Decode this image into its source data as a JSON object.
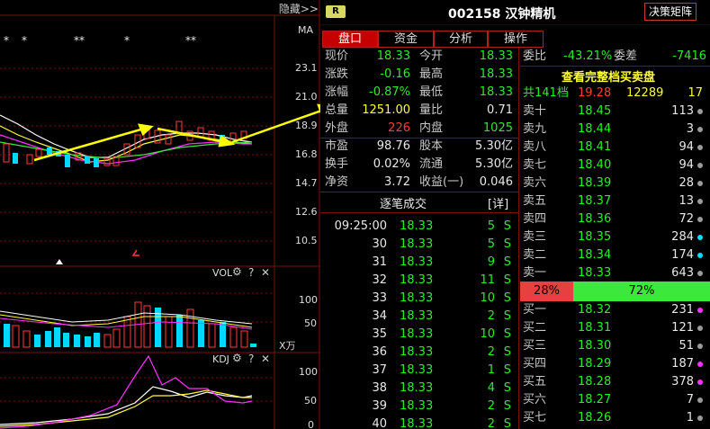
{
  "chart": {
    "hide_label": "隐藏>>",
    "ma_label": "MA",
    "star_markers": [
      "*",
      "*",
      "**",
      "*",
      "**"
    ],
    "price_ticks": [
      "23.1",
      "21.0",
      "18.9",
      "16.8",
      "14.7",
      "12.6",
      "10.5"
    ],
    "vol_label": "VOL",
    "vol_ticks": [
      "100",
      "50"
    ],
    "vol_unit": "X万",
    "kdj_label": "KDJ",
    "kdj_ticks": [
      "100",
      "50",
      "0"
    ],
    "gear_icon": "gear-icon",
    "help_icon": "question-icon",
    "close_icon": "close-icon"
  },
  "stock": {
    "badge": "R",
    "code_name": "002158 汉钟精机",
    "decision_button": "决策矩阵"
  },
  "tabs": [
    {
      "label": "盘口",
      "active": true
    },
    {
      "label": "资金",
      "active": false
    },
    {
      "label": "分析",
      "active": false
    },
    {
      "label": "操作",
      "active": false
    }
  ],
  "quote": [
    {
      "l1": "现价",
      "v1": "18.33",
      "c1": "green",
      "l2": "今开",
      "v2": "18.33",
      "c2": "green"
    },
    {
      "l1": "涨跌",
      "v1": "-0.16",
      "c1": "green",
      "l2": "最高",
      "v2": "18.33",
      "c2": "green"
    },
    {
      "l1": "涨幅",
      "v1": "-0.87%",
      "c1": "green",
      "l2": "最低",
      "v2": "18.33",
      "c2": "green"
    },
    {
      "l1": "总量",
      "v1": "1251.00",
      "c1": "yellow",
      "l2": "量比",
      "v2": "0.71",
      "c2": "white"
    },
    {
      "l1": "外盘",
      "v1": "226",
      "c1": "red",
      "l2": "内盘",
      "v2": "1025",
      "c2": "green"
    }
  ],
  "quote2": [
    {
      "l1": "市盈",
      "v1": "98.76",
      "l2": "股本",
      "v2": "5.30亿"
    },
    {
      "l1": "换手",
      "v1": "0.02%",
      "l2": "流通",
      "v2": "5.30亿"
    },
    {
      "l1": "净资",
      "v1": "3.72",
      "l2": "收益(一)",
      "v2": "0.046"
    }
  ],
  "trades": {
    "title": "逐笔成交",
    "detail": "[详]",
    "rows": [
      {
        "t": "09:25:00",
        "p": "18.33",
        "v": "5",
        "s": "S"
      },
      {
        "t": "30",
        "p": "18.33",
        "v": "5",
        "s": "S"
      },
      {
        "t": "31",
        "p": "18.33",
        "v": "9",
        "s": "S"
      },
      {
        "t": "32",
        "p": "18.33",
        "v": "11",
        "s": "S"
      },
      {
        "t": "33",
        "p": "18.33",
        "v": "10",
        "s": "S"
      },
      {
        "t": "34",
        "p": "18.33",
        "v": "2",
        "s": "S"
      },
      {
        "t": "35",
        "p": "18.33",
        "v": "10",
        "s": "S"
      },
      {
        "t": "36",
        "p": "18.33",
        "v": "2",
        "s": "S"
      },
      {
        "t": "37",
        "p": "18.33",
        "v": "1",
        "s": "S"
      },
      {
        "t": "38",
        "p": "18.33",
        "v": "4",
        "s": "S"
      },
      {
        "t": "39",
        "p": "18.33",
        "v": "2",
        "s": "S"
      },
      {
        "t": "40",
        "p": "18.33",
        "v": "2",
        "s": "S"
      }
    ]
  },
  "orderbook": {
    "weibi_label": "委比",
    "weibi_value": "-43.21%",
    "weicha_label": "委差",
    "weicha_value": "-7416",
    "full_link": "查看完整档买卖盘",
    "summary": {
      "label": "共141档",
      "price": "19.28",
      "vol": "12289",
      "count": "17"
    },
    "asks": [
      {
        "label": "卖十",
        "price": "18.45",
        "vol": "113",
        "dot": "gray"
      },
      {
        "label": "卖九",
        "price": "18.44",
        "vol": "3",
        "dot": "gray"
      },
      {
        "label": "卖八",
        "price": "18.41",
        "vol": "94",
        "dot": "gray"
      },
      {
        "label": "卖七",
        "price": "18.40",
        "vol": "94",
        "dot": "gray"
      },
      {
        "label": "卖六",
        "price": "18.39",
        "vol": "28",
        "dot": "gray"
      },
      {
        "label": "卖五",
        "price": "18.37",
        "vol": "13",
        "dot": "gray"
      },
      {
        "label": "卖四",
        "price": "18.36",
        "vol": "72",
        "dot": "gray"
      },
      {
        "label": "卖三",
        "price": "18.35",
        "vol": "284",
        "dot": "cyan"
      },
      {
        "label": "卖二",
        "price": "18.34",
        "vol": "174",
        "dot": "cyan"
      },
      {
        "label": "卖一",
        "price": "18.33",
        "vol": "643",
        "dot": "gray"
      }
    ],
    "ratio_left": "28%",
    "ratio_right": "72%",
    "ratio_left_fraction": 0.28,
    "bids": [
      {
        "label": "买一",
        "price": "18.32",
        "vol": "231",
        "dot": "magenta"
      },
      {
        "label": "买二",
        "price": "18.31",
        "vol": "121",
        "dot": "gray"
      },
      {
        "label": "买三",
        "price": "18.30",
        "vol": "51",
        "dot": "gray"
      },
      {
        "label": "买四",
        "price": "18.29",
        "vol": "187",
        "dot": "magenta"
      },
      {
        "label": "买五",
        "price": "18.28",
        "vol": "378",
        "dot": "magenta"
      },
      {
        "label": "买六",
        "price": "18.27",
        "vol": "7",
        "dot": "gray"
      },
      {
        "label": "买七",
        "price": "18.26",
        "vol": "1",
        "dot": "gray"
      }
    ]
  },
  "colors": {
    "up": "#ff3c3c",
    "down": "#2eea2e",
    "volume": "#ffff3c",
    "border": "#7a0f0f",
    "tab_active": "#c40000",
    "buy_bar": "#e84040",
    "sell_bar": "#3ce83c",
    "cyan": "#00e0ff",
    "magenta": "#ff30ff"
  }
}
